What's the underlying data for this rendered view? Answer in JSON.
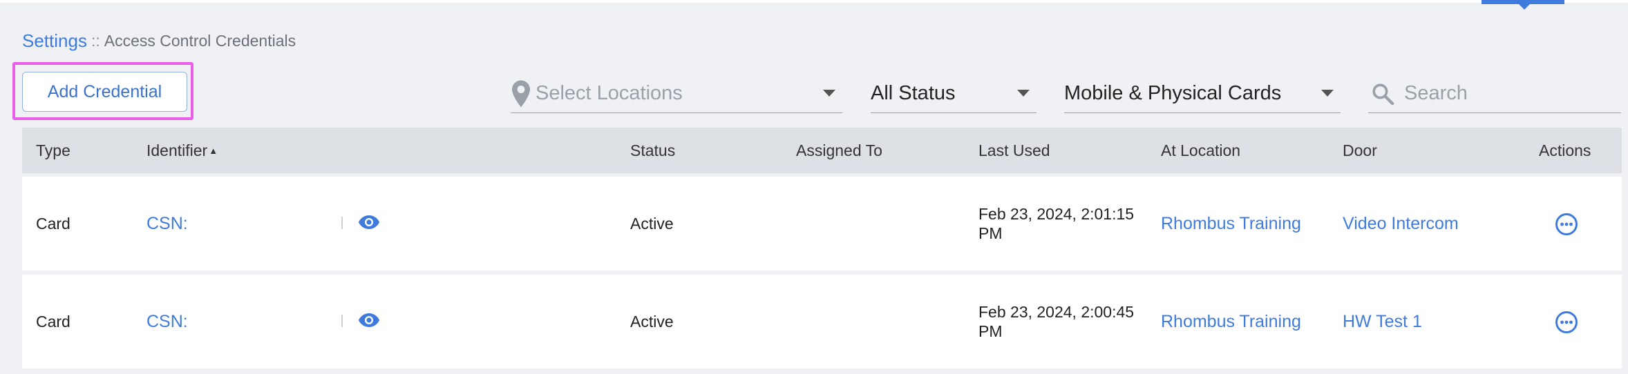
{
  "breadcrumb": {
    "root": "Settings",
    "separator": "::",
    "current": "Access Control Credentials"
  },
  "toolbar": {
    "add_label": "Add Credential",
    "locations_placeholder": "Select Locations",
    "status_value": "All Status",
    "card_type_value": "Mobile & Physical Cards",
    "search_placeholder": "Search"
  },
  "table": {
    "columns": {
      "type": "Type",
      "identifier": "Identifier",
      "identifier_sort": "▲",
      "status": "Status",
      "assigned_to": "Assigned To",
      "last_used": "Last Used",
      "at_location": "At Location",
      "door": "Door",
      "actions": "Actions"
    },
    "rows": [
      {
        "type": "Card",
        "identifier": "CSN:",
        "status": "Active",
        "assigned_to": "",
        "last_used_line1": "Feb 23, 2024, 2:01:15",
        "last_used_line2": "PM",
        "at_location": "Rhombus Training",
        "door": "Video Intercom"
      },
      {
        "type": "Card",
        "identifier": "CSN:",
        "status": "Active",
        "assigned_to": "",
        "last_used_line1": "Feb 23, 2024, 2:00:45",
        "last_used_line2": "PM",
        "at_location": "Rhombus Training",
        "door": "HW Test 1"
      }
    ]
  },
  "colors": {
    "accent": "#3e7bdc",
    "highlight": "#e85ee8",
    "header_bg": "#dde0e5",
    "page_bg": "#f0f1f5"
  },
  "icons": {
    "location": "map-pin-icon",
    "search": "search-icon",
    "reveal": "eye-icon",
    "actions": "more-horizontal-circle-icon"
  }
}
